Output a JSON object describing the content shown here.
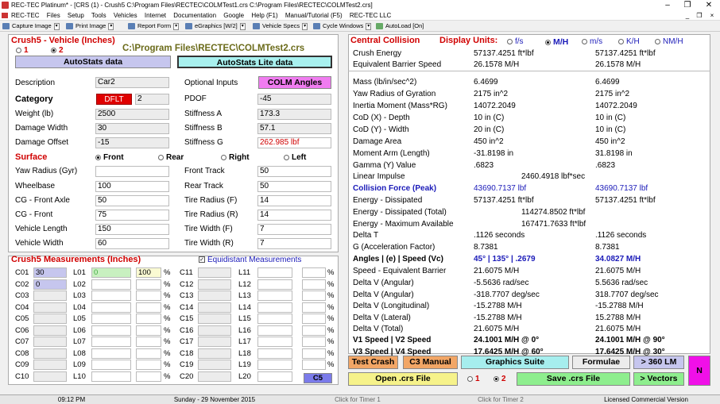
{
  "window": {
    "title": "REC-TEC Platinum* - [CRS (1) - Crush5  C:\\Program Files\\RECTEC\\COLMTest1.crs  C:\\Program Files\\RECTEC\\COLMTest2.crs]"
  },
  "menu": [
    "REC-TEC",
    "Files",
    "Setup",
    "Tools",
    "Vehicles",
    "Internet",
    "Documentation",
    "Google",
    "Help (F1)",
    "Manual/Tutorial (F5)",
    "REC-TEC LLC"
  ],
  "toolbar": [
    "Capture Image",
    "Print Image",
    "Report Form",
    "eGraphics [W/2]",
    "Vehicle Specs",
    "Cycle Windows",
    "AutoLoad [On]"
  ],
  "left": {
    "title": "Crush5 - Vehicle (Inches)",
    "radio1": "1",
    "radio2": "2",
    "path": "C:\\Program Files\\RECTEC\\COLMTest2.crs",
    "autostats": "AutoStats data",
    "autostats_lite": "AutoStats Lite data",
    "description_label": "Description",
    "description": "Car2",
    "optional_inputs": "Optional Inputs",
    "colm_angles": "COLM Angles",
    "category_label": "Category",
    "category_badge": "DFLT",
    "category_num": "2",
    "pdof_label": "PDOF",
    "pdof": "-45",
    "weight_label": "Weight (lb)",
    "weight": "2500",
    "stiffA_label": "Stiffness   A",
    "stiffA": "173.3",
    "dmgwidth_label": "Damage Width",
    "dmgwidth": "30",
    "stiffB_label": "Stiffness   B",
    "stiffB": "57.1",
    "dmgoffset_label": "Damage Offset",
    "dmgoffset": "-15",
    "stiffG_label": "Stiffness   G",
    "stiffG": "262.985  lbf",
    "surface_label": "Surface",
    "surfaces": [
      "Front",
      "Rear",
      "Right",
      "Left"
    ],
    "yaw_label": "Yaw Radius (Gyr)",
    "yaw": "",
    "fronttrack_label": "Front Track",
    "fronttrack": "50",
    "wheelbase_label": "Wheelbase",
    "wheelbase": "100",
    "reartrack_label": "Rear Track",
    "reartrack": "50",
    "cgfa_label": "CG - Front Axle",
    "cgfa": "50",
    "tireF_label": "Tire Radius (F)",
    "tireF": "14",
    "cgf_label": "CG - Front",
    "cgf": "75",
    "tireR_label": "Tire Radius (R)",
    "tireR": "14",
    "vlen_label": "Vehicle Length",
    "vlen": "150",
    "tireWF_label": "Tire Width (F)",
    "tireWF": "7",
    "vwid_label": "Vehicle Width",
    "vwid": "60",
    "tireWR_label": "Tire Width (R)",
    "tireWR": "7"
  },
  "measurements": {
    "title": "Crush5 Measurements (Inches)",
    "equidistant": "Equidistant Measurements",
    "c_labels": [
      "C01",
      "C02",
      "C03",
      "C04",
      "C05",
      "C06",
      "C07",
      "C08",
      "C09",
      "C10"
    ],
    "c_values": [
      "30",
      "0",
      "",
      "",
      "",
      "",
      "",
      "",
      "",
      ""
    ],
    "l_labels": [
      "L01",
      "L02",
      "L03",
      "L04",
      "L05",
      "L06",
      "L07",
      "L08",
      "L09",
      "L10"
    ],
    "l_values": [
      "0",
      "",
      "",
      "",
      "",
      "",
      "",
      "",
      "",
      ""
    ],
    "p_values": [
      "100",
      "",
      "",
      "",
      "",
      "",
      "",
      "",
      "",
      ""
    ],
    "c2_labels": [
      "C11",
      "C12",
      "C13",
      "C14",
      "C15",
      "C16",
      "C17",
      "C18",
      "C19",
      "C20"
    ],
    "l2_labels": [
      "L11",
      "L12",
      "L13",
      "L14",
      "L15",
      "L16",
      "L17",
      "L18",
      "L19",
      "L20"
    ],
    "pct": "%",
    "c5_button": "C5"
  },
  "right": {
    "title": "Central Collision",
    "display_units": "Display Units:",
    "units": [
      "f/s",
      "M/H",
      "m/s",
      "K/H",
      "NM/H"
    ],
    "rows": [
      [
        "Crush Energy",
        "57137.4251  ft*lbf",
        "57137.4251  ft*lbf"
      ],
      [
        "Equivalent Barrier Speed",
        "26.1578  M/H",
        "26.1578  M/H"
      ],
      [
        "Mass  (lb/in/sec^2)",
        "6.4699",
        "6.4699"
      ],
      [
        "Yaw Radius of Gyration",
        "2175  in^2",
        "2175  in^2"
      ],
      [
        "Inertia Moment (Mass*RG)",
        "14072.2049",
        "14072.2049"
      ],
      [
        "CoD (X) - Depth",
        "10  in (C)",
        "10  in (C)"
      ],
      [
        "CoD (Y) - Width",
        "20  in (C)",
        "10  in (C)"
      ],
      [
        "Damage Area",
        "450  in^2",
        "450  in^2"
      ],
      [
        "Moment Arm (Length)",
        "-31.8198  in",
        "31.8198  in"
      ],
      [
        "Gamma (Y) Value",
        ".6823",
        ".6823"
      ],
      [
        "Linear Impulse",
        "2460.4918  lbf*sec",
        ""
      ],
      [
        "Collision Force (Peak)",
        "43690.7137  lbf",
        "43690.7137  lbf"
      ],
      [
        "Energy - Dissipated",
        "57137.4251  ft*lbf",
        "57137.4251  ft*lbf"
      ],
      [
        "Energy - Dissipated (Total)",
        "114274.8502  ft*lbf",
        ""
      ],
      [
        "Energy - Maximum Available",
        "167471.7633  ft*lbf",
        ""
      ],
      [
        "Delta T",
        ".1126  seconds",
        ".1126  seconds"
      ],
      [
        "G (Acceleration Factor)",
        "8.7381",
        "8.7381"
      ],
      [
        "Angles | (e) | Speed (Vc)",
        "45° | 135° | .2679",
        "34.0827  M/H"
      ],
      [
        "Speed - Equivalent Barrier",
        "21.6075  M/H",
        "21.6075  M/H"
      ],
      [
        "Delta V (Angular)",
        "-5.5636  rad/sec",
        "5.5636  rad/sec"
      ],
      [
        "Delta V (Angular)",
        "-318.7707  deg/sec",
        "318.7707  deg/sec"
      ],
      [
        "Delta V (Longitudinal)",
        "-15.2788  M/H",
        "-15.2788  M/H"
      ],
      [
        "Delta V (Lateral)",
        "-15.2788  M/H",
        "15.2788  M/H"
      ],
      [
        "Delta V (Total)",
        "21.6075  M/H",
        "21.6075  M/H"
      ],
      [
        "V1 Speed | V2 Speed",
        "24.1001  M/H @ 0°",
        "24.1001  M/H @ 90°"
      ],
      [
        "V3 Speed | V4 Speed",
        "17.6425  M/H @ 60°",
        "17.6425  M/H @ 30°"
      ]
    ]
  },
  "buttons": {
    "test_crash": "Test Crash",
    "c3_manual": "C3 Manual",
    "graphics_suite": "Graphics Suite",
    "formulae": "Formulae",
    "gt360": "> 360 LM",
    "n": "N",
    "open_crs": "Open .crs File",
    "r1": "1",
    "r2": "2",
    "save_crs": "Save .crs File",
    "vectors": "> Vectors"
  },
  "status": {
    "time": "09:12 PM",
    "date": "Sunday   -  29 November 2015",
    "timer1": "Click for Timer 1",
    "timer2": "Click for Timer 2",
    "license": "Licensed Commercial Version"
  }
}
